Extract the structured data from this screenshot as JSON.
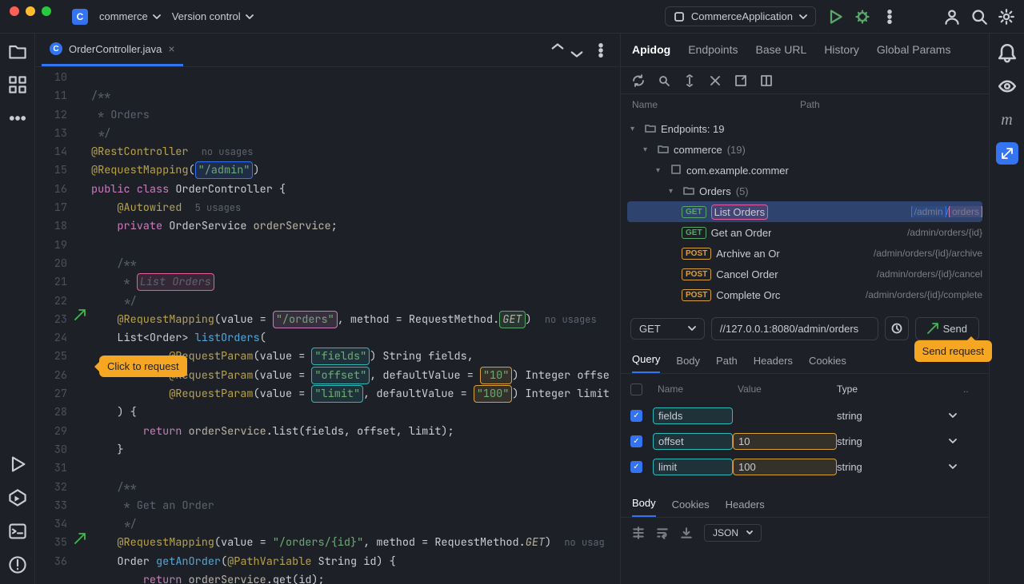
{
  "titlebar": {
    "project_initial": "C",
    "project": "commerce",
    "vcs": "Version control",
    "run_config": "CommerceApplication"
  },
  "editor": {
    "tab_name": "OrderController.java",
    "lines_start": 10,
    "code": {
      "l10": "/**",
      "l11": " * Orders",
      "l12": " */",
      "l13_anno": "@RestController",
      "l13_hint": "no usages",
      "l14_anno": "@RequestMapping",
      "l14_path": "\"/admin\"",
      "l15_kw1": "public",
      "l15_kw2": "class",
      "l15_name": "OrderController",
      "l16_anno": "@Autowired",
      "l16_hint": "5 usages",
      "l17_kw": "private",
      "l17_type": "OrderService",
      "l17_var": "orderService",
      "l19": "/**",
      "l20": "List Orders",
      "l21": " */",
      "l22_anno": "@RequestMapping",
      "l22_val": "value = ",
      "l22_path": "\"/orders\"",
      "l22_m": ", method = RequestMethod.",
      "l22_get": "GET",
      "l22_hint": "no usages",
      "l23_type": "List<Order>",
      "l23_name": "listOrders",
      "l24_anno": "@RequestParam",
      "l24_val": "(value = ",
      "l24_p": "\"fields\"",
      "l24_rest": ") String fields,",
      "l25_anno": "@RequestParam",
      "l25_val": "(value = ",
      "l25_p": "\"offset\"",
      "l25_d": ", defaultValue = ",
      "l25_dv": "\"10\"",
      "l25_rest": ") Integer offse",
      "l26_anno": "@RequestParam",
      "l26_val": "(value = ",
      "l26_p": "\"limit\"",
      "l26_d": ", defaultValue = ",
      "l26_dv": "\"100\"",
      "l26_rest": ") Integer limit",
      "l27": ") {",
      "l28_kw": "return",
      "l28_obj": "orderService",
      "l28_call": ".list(fields, offset, limit);",
      "l29": "}",
      "l31": "/**",
      "l32": " * Get an Order",
      "l33": " */",
      "l34_anno": "@RequestMapping",
      "l34_val": "(value = ",
      "l34_p": "\"/orders/{id}\"",
      "l34_m": ", method = RequestMethod.",
      "l34_get": "GET",
      "l34_hint": "no usag",
      "l35_type": "Order",
      "l35_name": "getAnOrder",
      "l35_pv": "@PathVariable",
      "l35_rest": " String id) {",
      "l36_kw": "return",
      "l36_obj": "orderService",
      "l36_call": ".get(id);"
    },
    "tooltip_click": "Click to request"
  },
  "apidog": {
    "tabs": [
      "Apidog",
      "Endpoints",
      "Base URL",
      "History",
      "Global Params"
    ],
    "headers": {
      "name": "Name",
      "path": "Path"
    },
    "tree": {
      "root": "Endpoints: 19",
      "folder1": "commerce",
      "folder1_count": "(19)",
      "folder2": "com.example.commer",
      "folder3": "Orders",
      "folder3_count": "(5)",
      "endpoints": [
        {
          "method": "GET",
          "name": "List Orders",
          "path": "/admin/orders"
        },
        {
          "method": "GET",
          "name": "Get an Order",
          "path": "/admin/orders/{id}"
        },
        {
          "method": "POST",
          "name": "Archive an Or",
          "path": "/admin/orders/{id}/archive"
        },
        {
          "method": "POST",
          "name": "Cancel Order",
          "path": "/admin/orders/{id}/cancel"
        },
        {
          "method": "POST",
          "name": "Complete Orc",
          "path": "/admin/orders/{id}/complete"
        }
      ]
    },
    "request": {
      "method": "GET",
      "url": "//127.0.0.1:8080/admin/orders",
      "send": "Send"
    },
    "send_tooltip": "Send request",
    "sub_tabs": [
      "Query",
      "Body",
      "Path",
      "Headers",
      "Cookies"
    ],
    "param_head": {
      "name": "Name",
      "value": "Value",
      "type": "Type"
    },
    "params": [
      {
        "checked": true,
        "name": "fields",
        "value": "",
        "type": "string"
      },
      {
        "checked": true,
        "name": "offset",
        "value": "10",
        "type": "string"
      },
      {
        "checked": true,
        "name": "limit",
        "value": "100",
        "type": "string"
      }
    ],
    "resp_tabs": [
      "Body",
      "Cookies",
      "Headers"
    ],
    "format": "JSON"
  }
}
